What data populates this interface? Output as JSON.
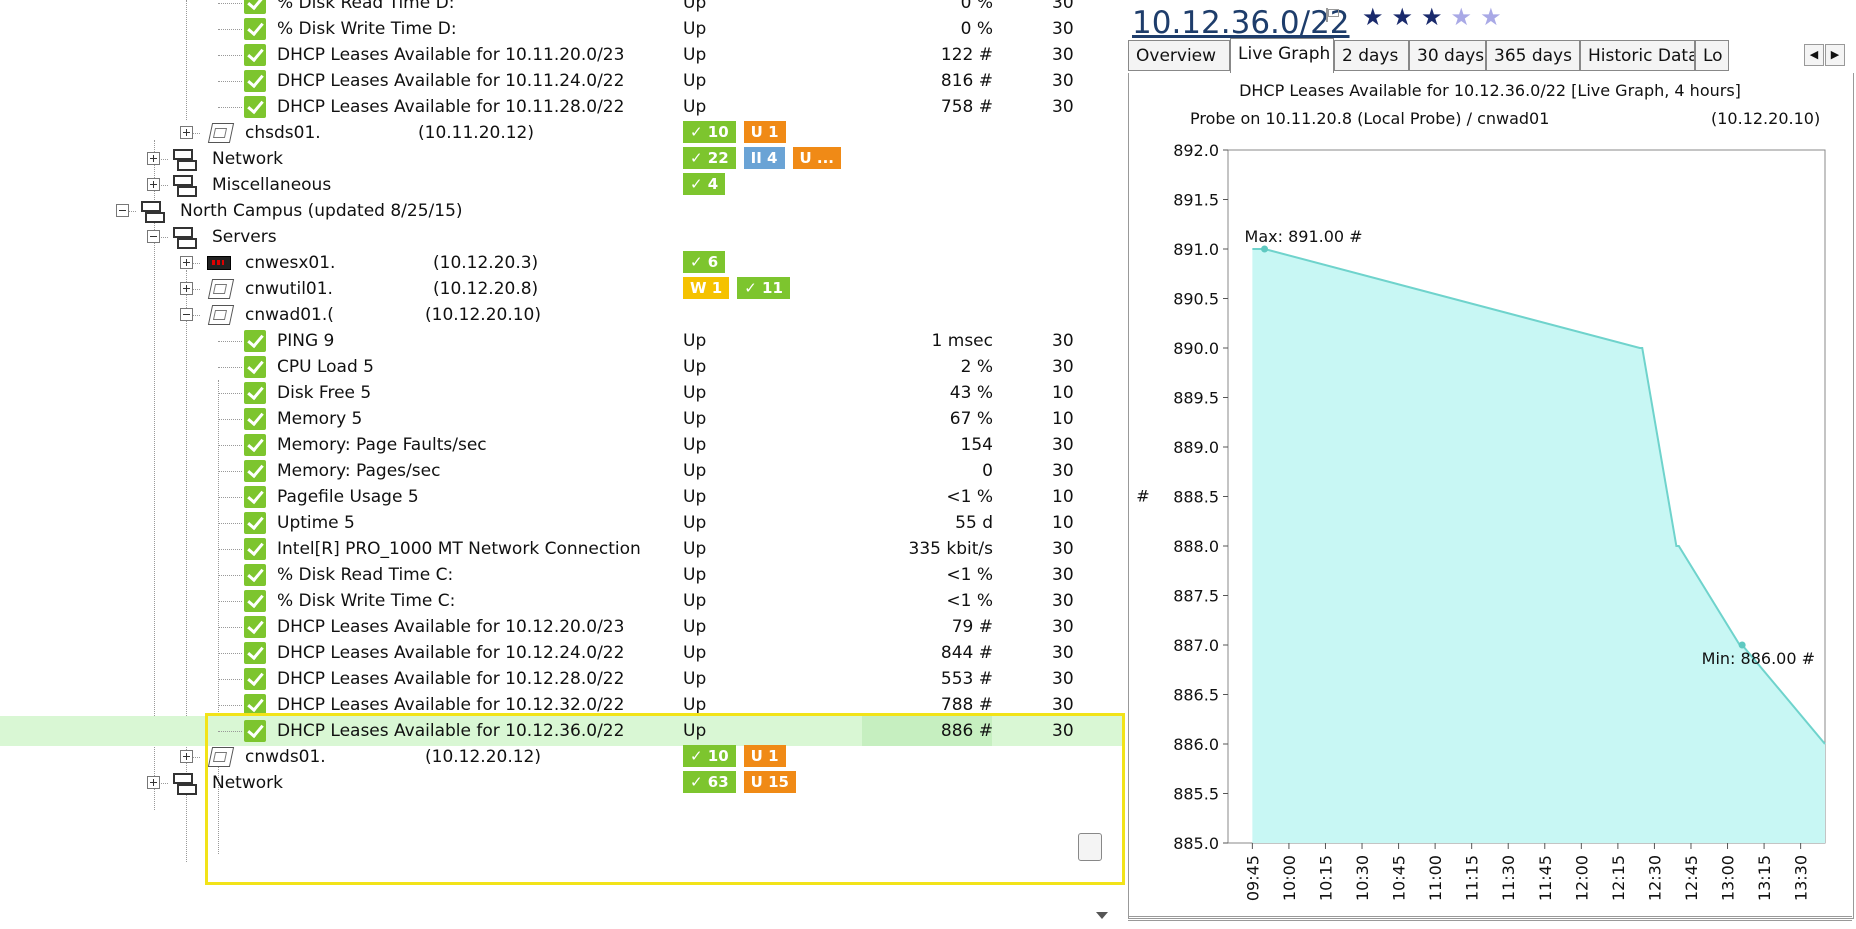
{
  "tree": {
    "rows": [
      {
        "label": "% Disk Read Time D:",
        "status": "Up",
        "value": "0 %",
        "interval": "30"
      },
      {
        "label": "% Disk Write Time D:",
        "status": "Up",
        "value": "0 %",
        "interval": "30"
      },
      {
        "label": "DHCP Leases Available for 10.11.20.0/23",
        "status": "Up",
        "value": "122 #",
        "interval": "30"
      },
      {
        "label": "DHCP Leases Available for 10.11.24.0/22",
        "status": "Up",
        "value": "816 #",
        "interval": "30"
      },
      {
        "label": "DHCP Leases Available for 10.11.28.0/22",
        "status": "Up",
        "value": "758 #",
        "interval": "30"
      },
      {
        "label": "chsds01.",
        "ip": "(10.11.20.12)",
        "badges": [
          {
            "text": "✓ 10",
            "color": "green"
          },
          {
            "text": "U 1",
            "color": "orange"
          }
        ]
      },
      {
        "label": "Network",
        "badges": [
          {
            "text": "✓ 22",
            "color": "green"
          },
          {
            "text": "II 4",
            "color": "blue"
          },
          {
            "text": "U ...",
            "color": "orange"
          }
        ]
      },
      {
        "label": "Miscellaneous",
        "badges": [
          {
            "text": "✓ 4",
            "color": "green"
          }
        ]
      },
      {
        "label": "North Campus (updated 8/25/15)"
      },
      {
        "label": "Servers"
      },
      {
        "label": "cnwesx01.",
        "ip": "(10.12.20.3)",
        "badges": [
          {
            "text": "✓ 6",
            "color": "green"
          }
        ]
      },
      {
        "label": "cnwutil01.",
        "ip": "(10.12.20.8)",
        "badges": [
          {
            "text": "W 1",
            "color": "yellow"
          },
          {
            "text": "✓ 11",
            "color": "green"
          }
        ]
      },
      {
        "label": "cnwad01.(",
        "ip": "(10.12.20.10)"
      },
      {
        "label": "PING 9",
        "status": "Up",
        "value": "1 msec",
        "interval": "30"
      },
      {
        "label": "CPU Load 5",
        "status": "Up",
        "value": "2 %",
        "interval": "30"
      },
      {
        "label": "Disk Free 5",
        "status": "Up",
        "value": "43 %",
        "interval": "10"
      },
      {
        "label": "Memory 5",
        "status": "Up",
        "value": "67 %",
        "interval": "10"
      },
      {
        "label": "Memory: Page Faults/sec",
        "status": "Up",
        "value": "154",
        "interval": "30"
      },
      {
        "label": "Memory: Pages/sec",
        "status": "Up",
        "value": "0",
        "interval": "30"
      },
      {
        "label": "Pagefile Usage 5",
        "status": "Up",
        "value": "<1 %",
        "interval": "10"
      },
      {
        "label": "Uptime 5",
        "status": "Up",
        "value": "55 d",
        "interval": "10"
      },
      {
        "label": "Intel[R] PRO_1000 MT Network Connection",
        "status": "Up",
        "value": "335 kbit/s",
        "interval": "30"
      },
      {
        "label": "% Disk Read Time C:",
        "status": "Up",
        "value": "<1 %",
        "interval": "30"
      },
      {
        "label": "% Disk Write Time C:",
        "status": "Up",
        "value": "<1 %",
        "interval": "30"
      },
      {
        "label": "DHCP Leases Available for 10.12.20.0/23",
        "status": "Up",
        "value": "79 #",
        "interval": "30"
      },
      {
        "label": "DHCP Leases Available for 10.12.24.0/22",
        "status": "Up",
        "value": "844 #",
        "interval": "30"
      },
      {
        "label": "DHCP Leases Available for 10.12.28.0/22",
        "status": "Up",
        "value": "553 #",
        "interval": "30"
      },
      {
        "label": "DHCP Leases Available for 10.12.32.0/22",
        "status": "Up",
        "value": "788 #",
        "interval": "30"
      },
      {
        "label": "DHCP Leases Available for 10.12.36.0/22",
        "status": "Up",
        "value": "886 #",
        "interval": "30"
      },
      {
        "label": "cnwds01.",
        "ip": "(10.12.20.12)",
        "badges": [
          {
            "text": "✓ 10",
            "color": "green"
          },
          {
            "text": "U 1",
            "color": "orange"
          }
        ]
      },
      {
        "label": "Network",
        "badges": [
          {
            "text": "✓ 63",
            "color": "green"
          },
          {
            "text": "U 15",
            "color": "orange"
          }
        ]
      }
    ]
  },
  "panel": {
    "title": "10.12.36.0/22",
    "stars": {
      "filled": 3,
      "total": 5
    },
    "tabs": [
      "Overview",
      "Live Graph",
      "2 days",
      "30 days",
      "365 days",
      "Historic Data",
      "Lo"
    ],
    "active_tab": "Live Graph"
  },
  "chart_data": {
    "type": "line",
    "title": "DHCP Leases Available for 10.12.36.0/22 [Live Graph, 4 hours]",
    "subtitle_left": "Probe on 10.11.20.8 (Local Probe) / cnwad01",
    "subtitle_right": "(10.12.20.10)",
    "ylabel": "#",
    "ylim": [
      885.0,
      892.0
    ],
    "y_ticks": [
      "892.0",
      "891.5",
      "891.0",
      "890.5",
      "890.0",
      "889.5",
      "889.0",
      "888.5",
      "888.0",
      "887.5",
      "887.0",
      "886.5",
      "886.0",
      "885.5",
      "885.0"
    ],
    "x_ticks": [
      "09:45",
      "10:00",
      "10:15",
      "10:30",
      "10:45",
      "11:00",
      "11:15",
      "11:30",
      "11:45",
      "12:00",
      "12:15",
      "12:30",
      "12:45",
      "13:00",
      "13:15",
      "13:30"
    ],
    "step_series": {
      "x": [
        "09:45",
        "09:50",
        "12:24",
        "12:25",
        "12:39",
        "12:40",
        "13:05",
        "13:06",
        "13:36"
      ],
      "y": [
        891,
        891,
        890,
        890,
        888,
        888,
        887,
        887,
        886
      ]
    },
    "annotations": {
      "max": "Max: 891.00 #",
      "min": "Min: 886.00 #"
    },
    "fill_color": "#c8f7f4",
    "line_color": "#6fd3cc"
  }
}
